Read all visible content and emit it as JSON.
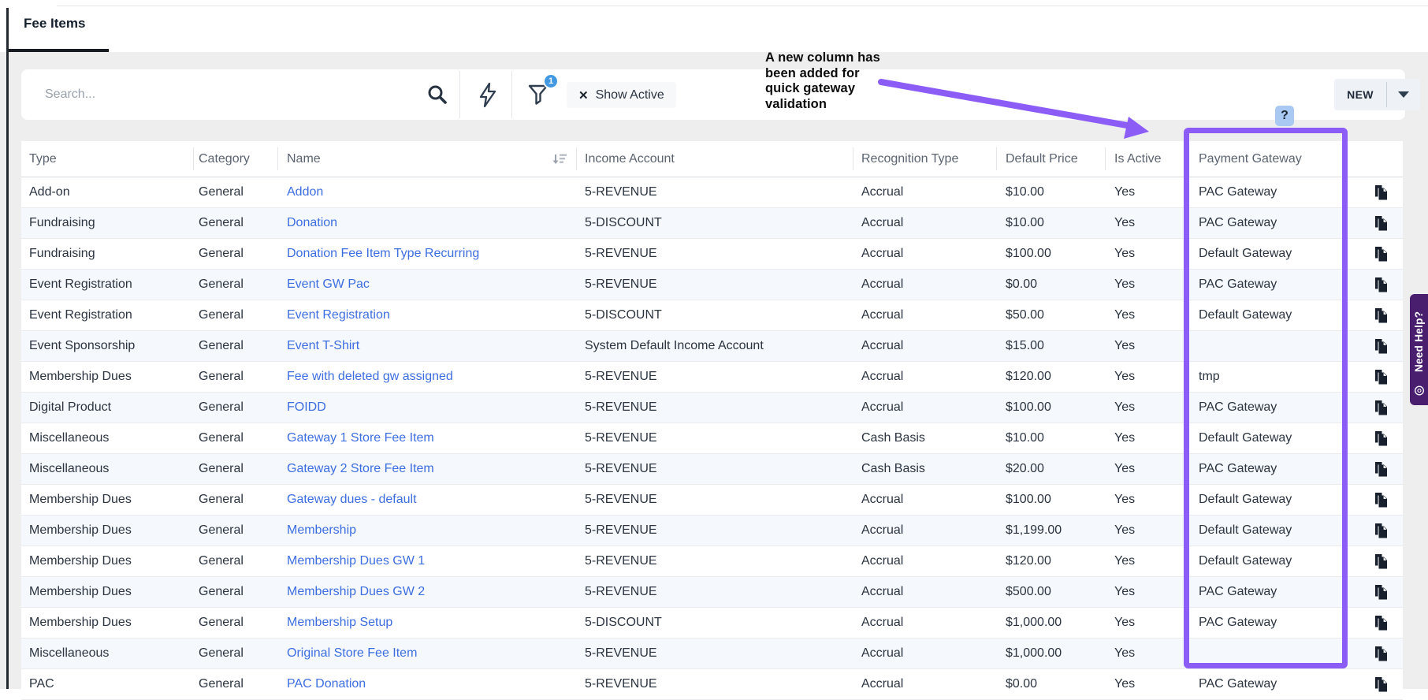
{
  "tab_bar": {
    "active_tab": "Fee Items"
  },
  "toolbar": {
    "search_placeholder": "Search...",
    "filter_badge": "1",
    "filter_chip_clear": "✕",
    "filter_chip_label": "Show Active",
    "new_button": "NEW",
    "help_badge": "?"
  },
  "annotation": {
    "text_lines": [
      "A new column has",
      "been added for",
      "quick gateway",
      "validation"
    ]
  },
  "help_tab": {
    "label": "Need Help?"
  },
  "colors": {
    "highlight_purple": "#8b5cf6",
    "link_blue": "#3d6ee0",
    "filter_badge_blue": "#4299e1",
    "help_badge_blue": "#a9c9f3",
    "help_tab_purple": "#4a1e6f",
    "row_alt_blue": "#f5f8fc"
  },
  "table": {
    "columns": [
      "Type",
      "Category",
      "Name",
      "Income Account",
      "Recognition Type",
      "Default Price",
      "Is Active",
      "Payment Gateway"
    ],
    "rows": [
      {
        "type": "Add-on",
        "category": "General",
        "name": "Addon",
        "income": "5-REVENUE",
        "recognition": "Accrual",
        "price": "$10.00",
        "active": "Yes",
        "gateway": "PAC Gateway"
      },
      {
        "type": "Fundraising",
        "category": "General",
        "name": "Donation",
        "income": "5-DISCOUNT",
        "recognition": "Accrual",
        "price": "$10.00",
        "active": "Yes",
        "gateway": "PAC Gateway"
      },
      {
        "type": "Fundraising",
        "category": "General",
        "name": "Donation Fee Item Type Recurring",
        "income": "5-REVENUE",
        "recognition": "Accrual",
        "price": "$100.00",
        "active": "Yes",
        "gateway": "Default Gateway"
      },
      {
        "type": "Event Registration",
        "category": "General",
        "name": "Event GW Pac",
        "income": "5-REVENUE",
        "recognition": "Accrual",
        "price": "$0.00",
        "active": "Yes",
        "gateway": "PAC Gateway"
      },
      {
        "type": "Event Registration",
        "category": "General",
        "name": "Event Registration",
        "income": "5-DISCOUNT",
        "recognition": "Accrual",
        "price": "$50.00",
        "active": "Yes",
        "gateway": "Default Gateway"
      },
      {
        "type": "Event Sponsorship",
        "category": "General",
        "name": "Event T-Shirt",
        "income": "System Default Income Account",
        "recognition": "Accrual",
        "price": "$15.00",
        "active": "Yes",
        "gateway": ""
      },
      {
        "type": "Membership Dues",
        "category": "General",
        "name": "Fee with deleted gw assigned",
        "income": "5-REVENUE",
        "recognition": "Accrual",
        "price": "$120.00",
        "active": "Yes",
        "gateway": "tmp"
      },
      {
        "type": "Digital Product",
        "category": "General",
        "name": "FOIDD",
        "income": "5-REVENUE",
        "recognition": "Accrual",
        "price": "$100.00",
        "active": "Yes",
        "gateway": "PAC Gateway"
      },
      {
        "type": "Miscellaneous",
        "category": "General",
        "name": "Gateway 1 Store Fee Item",
        "income": "5-REVENUE",
        "recognition": "Cash Basis",
        "price": "$10.00",
        "active": "Yes",
        "gateway": "Default Gateway"
      },
      {
        "type": "Miscellaneous",
        "category": "General",
        "name": "Gateway 2 Store Fee Item",
        "income": "5-REVENUE",
        "recognition": "Cash Basis",
        "price": "$20.00",
        "active": "Yes",
        "gateway": "PAC Gateway"
      },
      {
        "type": "Membership Dues",
        "category": "General",
        "name": "Gateway dues - default",
        "income": "5-REVENUE",
        "recognition": "Accrual",
        "price": "$100.00",
        "active": "Yes",
        "gateway": "Default Gateway"
      },
      {
        "type": "Membership Dues",
        "category": "General",
        "name": "Membership",
        "income": "5-REVENUE",
        "recognition": "Accrual",
        "price": "$1,199.00",
        "active": "Yes",
        "gateway": "Default Gateway"
      },
      {
        "type": "Membership Dues",
        "category": "General",
        "name": "Membership Dues GW 1",
        "income": "5-REVENUE",
        "recognition": "Accrual",
        "price": "$120.00",
        "active": "Yes",
        "gateway": "Default Gateway"
      },
      {
        "type": "Membership Dues",
        "category": "General",
        "name": "Membership Dues GW 2",
        "income": "5-REVENUE",
        "recognition": "Accrual",
        "price": "$500.00",
        "active": "Yes",
        "gateway": "PAC Gateway"
      },
      {
        "type": "Membership Dues",
        "category": "General",
        "name": "Membership Setup",
        "income": "5-DISCOUNT",
        "recognition": "Accrual",
        "price": "$1,000.00",
        "active": "Yes",
        "gateway": "PAC Gateway"
      },
      {
        "type": "Miscellaneous",
        "category": "General",
        "name": "Original Store Fee Item",
        "income": "5-REVENUE",
        "recognition": "Accrual",
        "price": "$1,000.00",
        "active": "Yes",
        "gateway": ""
      },
      {
        "type": "PAC",
        "category": "General",
        "name": "PAC Donation",
        "income": "5-REVENUE",
        "recognition": "Accrual",
        "price": "$0.00",
        "active": "Yes",
        "gateway": "PAC Gateway"
      }
    ]
  }
}
